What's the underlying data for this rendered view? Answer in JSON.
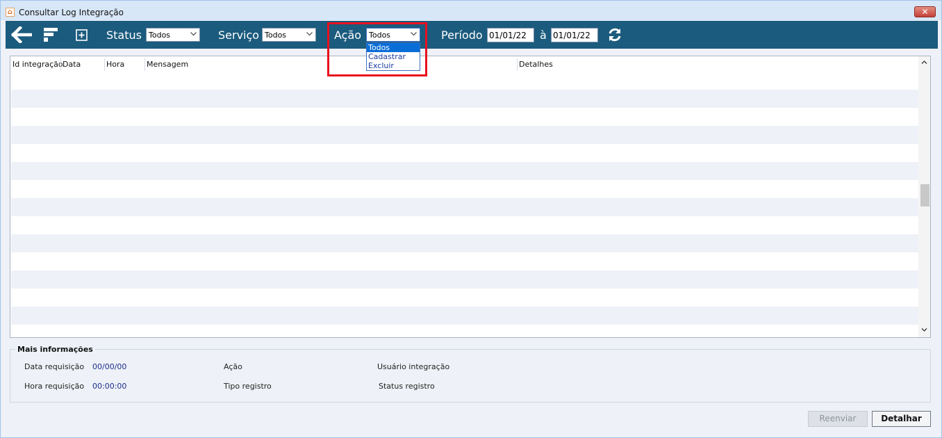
{
  "window": {
    "title": "Consultar Log Integração",
    "close_label": "✕"
  },
  "toolbar": {
    "status_label": "Status",
    "status_value": "Todos",
    "servico_label": "Serviço",
    "servico_value": "Todos",
    "acao_label": "Ação",
    "acao_value": "Todos",
    "periodo_label": "Período",
    "date_from": "01/01/22",
    "date_sep": "à",
    "date_to": "01/01/22"
  },
  "acao_dropdown": {
    "options": [
      "Todos",
      "Cadastrar",
      "Excluir"
    ],
    "selected": "Todos"
  },
  "grid": {
    "columns": [
      "Id integração",
      "Data",
      "Hora",
      "Mensagem",
      "Detalhes"
    ],
    "rows": []
  },
  "info": {
    "title": "Mais informações",
    "data_requisicao_label": "Data requisição",
    "data_requisicao_value": "00/00/00",
    "hora_requisicao_label": "Hora requisição",
    "hora_requisicao_value": "00:00:00",
    "acao_label": "Ação",
    "tipo_registro_label": "Tipo registro",
    "usuario_integracao_label": "Usuário integração",
    "status_registro_label": "Status registro"
  },
  "buttons": {
    "reenviar": "Reenviar",
    "detalhar": "Detalhar"
  },
  "colors": {
    "toolbar": "#1b5b7e",
    "highlight": "#e8101e",
    "selection": "#0a6ed8"
  },
  "icons": [
    "back-arrow-icon",
    "filter-icon",
    "add-box-icon",
    "refresh-icon",
    "chevron-down-icon"
  ]
}
